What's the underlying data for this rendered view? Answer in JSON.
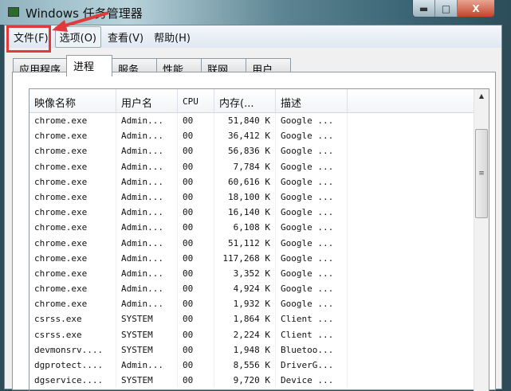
{
  "window": {
    "title": "Windows 任务管理器",
    "minimize": "▬",
    "maximize": "□",
    "close": "X"
  },
  "menu": [
    "文件(F)",
    "选项(O)",
    "查看(V)",
    "帮助(H)"
  ],
  "tabs": [
    "应用程序",
    "进程",
    "服务",
    "性能",
    "联网",
    "用户"
  ],
  "columns": [
    "映像名称",
    "用户名",
    "CPU",
    "内存(...",
    "描述"
  ],
  "rows": [
    [
      "chrome.exe",
      "Admin...",
      "00",
      "51,840 K",
      "Google ..."
    ],
    [
      "chrome.exe",
      "Admin...",
      "00",
      "36,412 K",
      "Google ..."
    ],
    [
      "chrome.exe",
      "Admin...",
      "00",
      "56,836 K",
      "Google ..."
    ],
    [
      "chrome.exe",
      "Admin...",
      "00",
      "7,784 K",
      "Google ..."
    ],
    [
      "chrome.exe",
      "Admin...",
      "00",
      "60,616 K",
      "Google ..."
    ],
    [
      "chrome.exe",
      "Admin...",
      "00",
      "18,100 K",
      "Google ..."
    ],
    [
      "chrome.exe",
      "Admin...",
      "00",
      "16,140 K",
      "Google ..."
    ],
    [
      "chrome.exe",
      "Admin...",
      "00",
      "6,108 K",
      "Google ..."
    ],
    [
      "chrome.exe",
      "Admin...",
      "00",
      "51,112 K",
      "Google ..."
    ],
    [
      "chrome.exe",
      "Admin...",
      "00",
      "117,268 K",
      "Google ..."
    ],
    [
      "chrome.exe",
      "Admin...",
      "00",
      "3,352 K",
      "Google ..."
    ],
    [
      "chrome.exe",
      "Admin...",
      "00",
      "4,924 K",
      "Google ..."
    ],
    [
      "chrome.exe",
      "Admin...",
      "00",
      "1,932 K",
      "Google ..."
    ],
    [
      "csrss.exe",
      "SYSTEM",
      "00",
      "1,864 K",
      "Client ..."
    ],
    [
      "csrss.exe",
      "SYSTEM",
      "00",
      "2,224 K",
      "Client ..."
    ],
    [
      "devmonsrv....",
      "SYSTEM",
      "00",
      "1,948 K",
      "Bluetoo..."
    ],
    [
      "dgprotect....",
      "Admin...",
      "00",
      "8,556 K",
      "DriverG..."
    ],
    [
      "dgservice....",
      "SYSTEM",
      "00",
      "9,720 K",
      "Device ..."
    ]
  ],
  "colors": {
    "highlight": "#e03a3a"
  }
}
